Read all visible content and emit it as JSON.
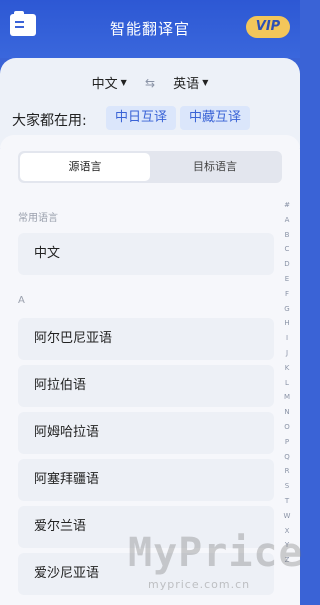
{
  "header": {
    "title": "智能翻译官",
    "vip_label": "VIP"
  },
  "translator": {
    "source_lang": "中文",
    "target_lang": "英语",
    "popular_label": "大家都在用:",
    "chips": [
      "中日互译",
      "中藏互译"
    ]
  },
  "picker": {
    "tabs": [
      "源语言",
      "目标语言"
    ],
    "common_section": "常用语言",
    "common_items": [
      "中文"
    ],
    "a_section": "A",
    "a_items": [
      "阿尔巴尼亚语",
      "阿拉伯语",
      "阿姆哈拉语",
      "阿塞拜疆语",
      "爱尔兰语",
      "爱沙尼亚语"
    ],
    "index_letters": [
      "#",
      "A",
      "B",
      "C",
      "D",
      "E",
      "F",
      "G",
      "H",
      "I",
      "J",
      "K",
      "L",
      "M",
      "N",
      "O",
      "P",
      "Q",
      "R",
      "S",
      "T",
      "W",
      "X",
      "Y",
      "Z"
    ]
  },
  "watermark": {
    "main": "MyPrice",
    "sub": "myprice.com.cn"
  },
  "colors": {
    "primary": "#3a63d6",
    "vip": "#f3c65a"
  }
}
